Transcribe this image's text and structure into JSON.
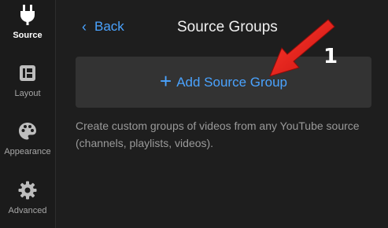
{
  "sidebar": {
    "items": [
      {
        "label": "Source",
        "icon": "plug-icon",
        "active": true
      },
      {
        "label": "Layout",
        "icon": "layout-icon",
        "active": false
      },
      {
        "label": "Appearance",
        "icon": "palette-icon",
        "active": false
      },
      {
        "label": "Advanced",
        "icon": "gear-icon",
        "active": false
      }
    ]
  },
  "header": {
    "back_label": "Back",
    "title": "Source Groups"
  },
  "main": {
    "add_button_label": "Add Source Group",
    "description": "Create custom groups of videos from any YouTube source (channels, playlists, videos)."
  },
  "annotation": {
    "number": "1",
    "color": "#e0201c"
  },
  "colors": {
    "accent": "#4aa3ff",
    "background": "#1e1e1e",
    "button_bg": "#333333"
  }
}
